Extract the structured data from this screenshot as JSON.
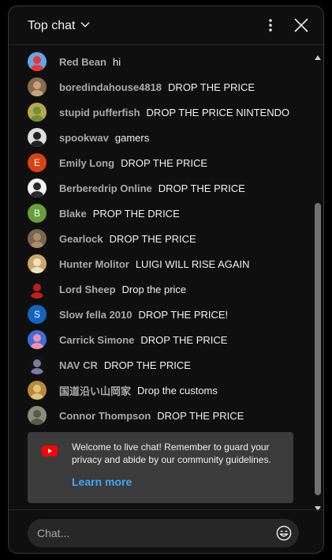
{
  "header": {
    "title": "Top chat"
  },
  "messages": [
    {
      "author": "Red Bean",
      "text": "hi",
      "avatar": {
        "kind": "image",
        "bg": "#5fa8e8",
        "fg": "#e33"
      }
    },
    {
      "author": "boredindahouse4818",
      "text": "DROP THE PRICE",
      "avatar": {
        "kind": "image",
        "bg": "#8a6a4e",
        "fg": "#c7a37a"
      }
    },
    {
      "author": "stupid pufferfish",
      "text": "DROP THE PRICE NINTENDO",
      "avatar": {
        "kind": "image",
        "bg": "#b8a84a",
        "fg": "#6e8f3c"
      }
    },
    {
      "author": "spookwav",
      "text": "gamers",
      "avatar": {
        "kind": "image",
        "bg": "#dddddd",
        "fg": "#222222"
      }
    },
    {
      "author": "Emily Long",
      "text": "DROP THE PRICE",
      "avatar": {
        "kind": "letter",
        "letter": "E",
        "bg": "#d84315"
      }
    },
    {
      "author": "Berberedrip Online",
      "text": "DROP THE PRICE",
      "avatar": {
        "kind": "image",
        "bg": "#f2f2f2",
        "fg": "#2b2b2b"
      }
    },
    {
      "author": "Blake",
      "text": "PROP THE DRICE",
      "avatar": {
        "kind": "letter",
        "letter": "B",
        "bg": "#689f38"
      }
    },
    {
      "author": "Gearlock",
      "text": "DROP THE PRICE",
      "avatar": {
        "kind": "image",
        "bg": "#7a6650",
        "fg": "#a98e6c"
      }
    },
    {
      "author": "Hunter Molitor",
      "text": "LUIGI WILL RISE AGAIN",
      "avatar": {
        "kind": "image",
        "bg": "#c9a86a",
        "fg": "#f0e0c0"
      }
    },
    {
      "author": "Lord Sheep",
      "text": "Drop the price",
      "avatar": {
        "kind": "image",
        "bg": "#0f0f0f",
        "fg": "#c0201a"
      }
    },
    {
      "author": "Slow fella 2010",
      "text": "DROP THE PRICE!",
      "avatar": {
        "kind": "letter",
        "letter": "S",
        "bg": "#1565c0"
      }
    },
    {
      "author": "Carrick Simone",
      "text": "DROP THE PRICE",
      "avatar": {
        "kind": "image",
        "bg": "#3a6fd8",
        "fg": "#f48fb1"
      }
    },
    {
      "author": "NAV CR",
      "text": "DROP THE PRICE",
      "avatar": {
        "kind": "image",
        "bg": "#111111",
        "fg": "#7b7b9a"
      }
    },
    {
      "author": "国道沿い山岡家",
      "text": "Drop the customs",
      "avatar": {
        "kind": "image",
        "bg": "#b88a3a",
        "fg": "#e2c27a"
      }
    },
    {
      "author": "Connor Thompson",
      "text": "DROP THE PRICE",
      "avatar": {
        "kind": "image",
        "bg": "#8a8f7a",
        "fg": "#5a5a4a"
      }
    }
  ],
  "notice": {
    "text": "Welcome to live chat! Remember to guard your privacy and abide by our community guidelines.",
    "link": "Learn more"
  },
  "input": {
    "placeholder": "Chat..."
  },
  "icons": {
    "dropdown": "chevron-down-icon",
    "menu": "more-vert-icon",
    "close": "close-icon",
    "emoji": "emoji-icon",
    "brand": "youtube-logo-icon"
  },
  "colors": {
    "accent": "#3ea6ff",
    "brand": "#ff0000",
    "background": "#0f0f0f"
  }
}
